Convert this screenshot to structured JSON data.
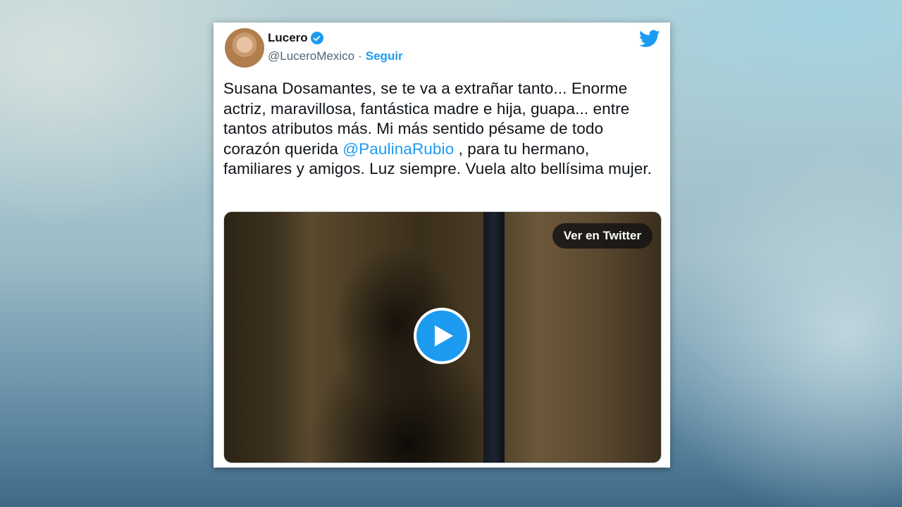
{
  "author": {
    "name": "Lucero",
    "handle": "@LuceroMexico",
    "separator": "·",
    "follow_label": "Seguir"
  },
  "tweet": {
    "text_before": "Susana Dosamantes, se te va a extrañar tanto... Enorme actriz, maravillosa, fantástica madre e hija, guapa... entre tantos atributos más. Mi más sentido pésame de todo corazón querida ",
    "mention": "@PaulinaRubio",
    "text_after": " , para tu hermano, familiares y amigos. Luz siempre. Vuela alto bellísima mujer."
  },
  "media": {
    "view_label": "Ver en Twitter",
    "play_icon": "play-icon"
  },
  "icons": {
    "brand": "twitter-bird-icon",
    "verified": "verified-badge-icon"
  },
  "colors": {
    "accent": "#1d9bf0",
    "text": "#0f1419",
    "secondary": "#536471"
  }
}
